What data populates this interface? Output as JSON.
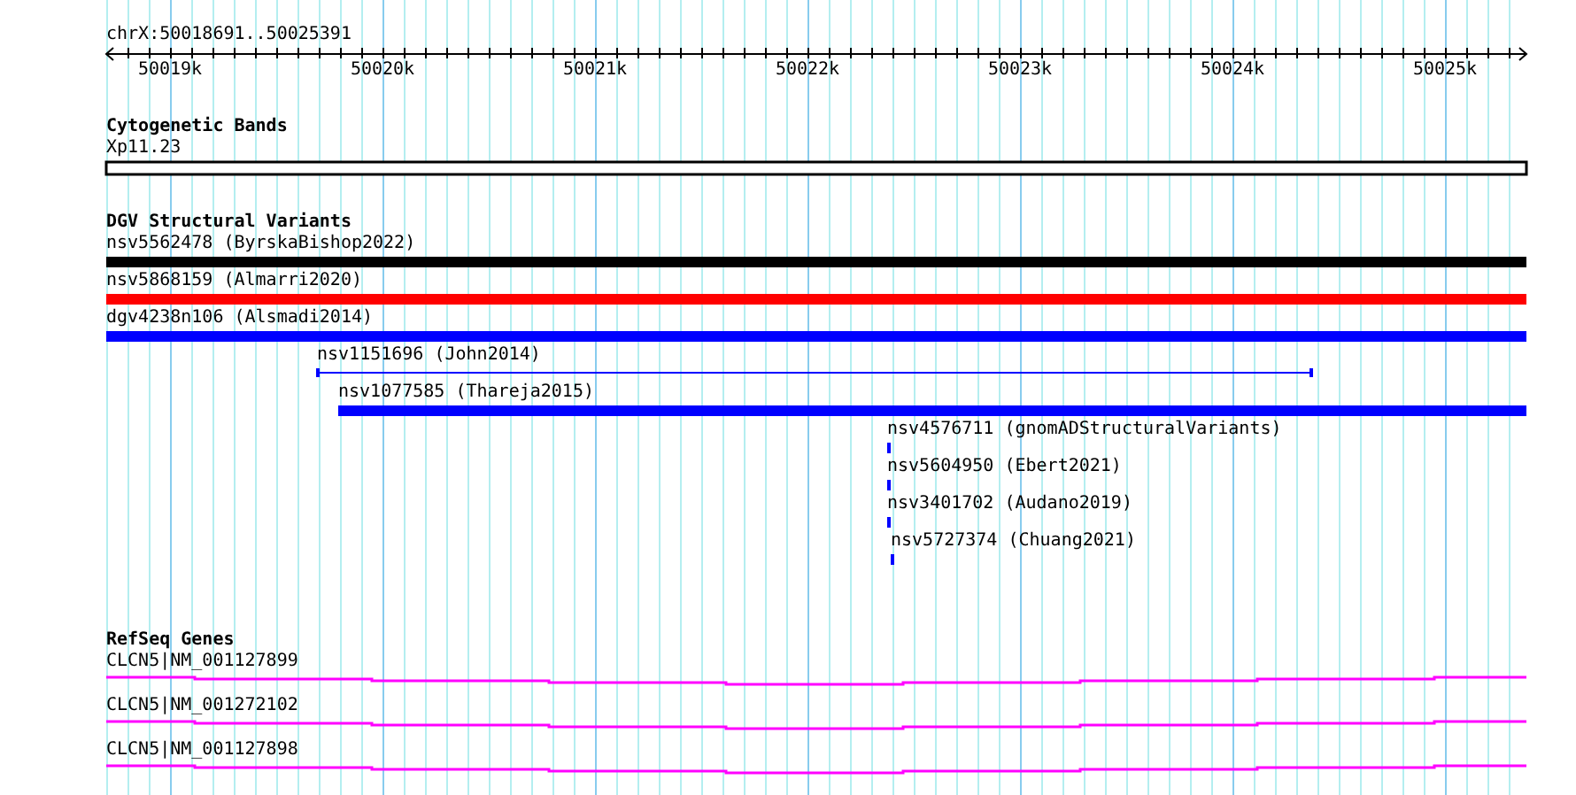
{
  "ruler": {
    "location": "chrX:50018691..50025391",
    "tick_labels": [
      "50019k",
      "50020k",
      "50021k",
      "50022k",
      "50023k",
      "50024k",
      "50025k"
    ]
  },
  "tracks": [
    {
      "kind": "cytoband",
      "title": "Cytogenetic Bands",
      "bands": [
        {
          "label": "Xp11.23"
        }
      ]
    },
    {
      "kind": "variants",
      "title": "DGV Structural Variants",
      "features": [
        {
          "label": "nsv5562478 (ByrskaBishop2022)",
          "kind": "bar",
          "color": "#000000"
        },
        {
          "label": "nsv5868159 (Almarri2020)",
          "kind": "bar",
          "color": "#ff0000"
        },
        {
          "label": "dgv4238n106 (Alsmadi2014)",
          "kind": "bar",
          "color": "#0000ff"
        },
        {
          "label": "nsv1151696 (John2014)",
          "kind": "line",
          "color": "#0000ff"
        },
        {
          "label": "nsv1077585 (Thareja2015)",
          "kind": "bar",
          "color": "#0000ff"
        },
        {
          "label": "nsv4576711 (gnomADStructuralVariants)",
          "kind": "bar",
          "color": "#0000ff"
        },
        {
          "label": "nsv5604950 (Ebert2021)",
          "kind": "bar",
          "color": "#0000ff"
        },
        {
          "label": "nsv3401702 (Audano2019)",
          "kind": "bar",
          "color": "#0000ff"
        },
        {
          "label": "nsv5727374 (Chuang2021)",
          "kind": "bar",
          "color": "#0000ff"
        }
      ]
    },
    {
      "kind": "genes",
      "title": "RefSeq Genes",
      "genes": [
        {
          "label": "CLCN5|NM_001127899"
        },
        {
          "label": "CLCN5|NM_001272102"
        },
        {
          "label": "CLCN5|NM_001127898"
        }
      ]
    }
  ]
}
